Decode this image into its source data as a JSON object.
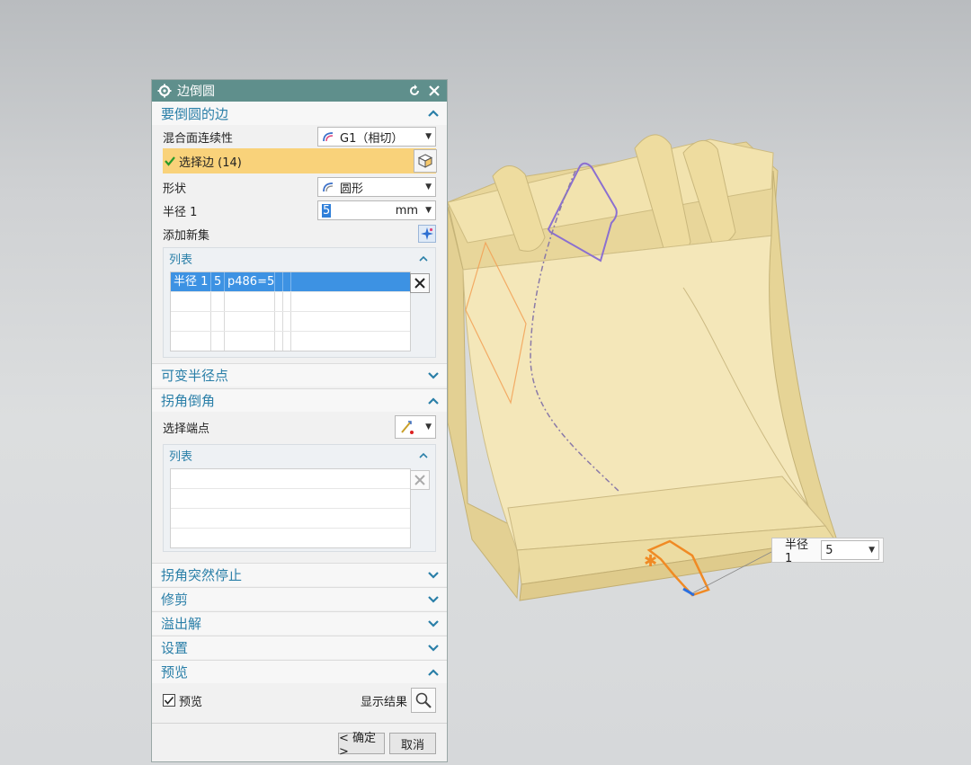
{
  "dialog": {
    "title": "边倒圆",
    "sections": {
      "edges": {
        "header": "要倒圆的边",
        "continuity_label": "混合面连续性",
        "continuity_value": "G1（相切）",
        "select_edge": "选择边 (14)",
        "shape_label": "形状",
        "shape_value": "圆形",
        "radius_label": "半径 1",
        "radius_value": "5",
        "radius_unit": "mm",
        "add_set": "添加新集",
        "list": {
          "header": "列表",
          "rows": [
            [
              "半径 1",
              "5",
              "p486=5",
              "",
              "",
              ""
            ],
            [
              "",
              "",
              "",
              "",
              "",
              ""
            ],
            [
              "",
              "",
              "",
              "",
              "",
              ""
            ],
            [
              "",
              "",
              "",
              "",
              "",
              ""
            ]
          ]
        }
      },
      "variable_radius": {
        "header": "可变半径点"
      },
      "corner_setback": {
        "header": "拐角倒角",
        "select_endpoint": "选择端点",
        "list": {
          "header": "列表"
        }
      },
      "corner_stop": {
        "header": "拐角突然停止"
      },
      "trim": {
        "header": "修剪"
      },
      "overflow": {
        "header": "溢出解"
      },
      "settings": {
        "header": "设置"
      },
      "preview": {
        "header": "预览",
        "preview_checkbox": "预览",
        "preview_checked": true,
        "show_result": "显示结果"
      }
    },
    "buttons": {
      "ok": "< 确定 >",
      "cancel": "取消"
    }
  },
  "viewport": {
    "float_radius_label": "半径 1",
    "float_radius_value": "5"
  },
  "colors": {
    "title_bar": "#5f8f8c",
    "section_header": "#2a7fa8",
    "selection_row": "#f9d27a",
    "selected_list_row": "#3d92e3",
    "model_body": "#efdfa6",
    "highlight_orange": "#f08a24",
    "highlight_purple": "#8b6fd0"
  }
}
